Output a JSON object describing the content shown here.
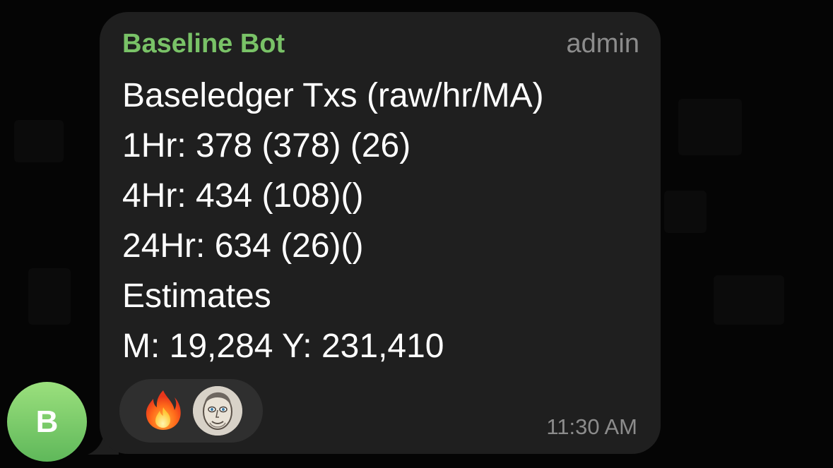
{
  "message": {
    "sender_name": "Baseline Bot",
    "sender_role": "admin",
    "lines": [
      "Baseledger Txs (raw/hr/MA)",
      "1Hr: 378 (378) (26)",
      "4Hr: 434 (108)()",
      "24Hr: 634 (26)()",
      "Estimates",
      "M: 19,284 Y: 231,410"
    ],
    "time": "11:30 AM"
  },
  "reactions": [
    {
      "icon": "fire-emoji-icon"
    },
    {
      "icon": "user-avatar-reaction"
    }
  ],
  "avatar": {
    "letter": "B"
  },
  "colors": {
    "sender_name": "#79c267",
    "bubble": "#1f1f1f",
    "reaction_pill": "#2f2f2f",
    "meta_text": "#8c8c8c",
    "avatar_gradient_top": "#9be07d",
    "avatar_gradient_bottom": "#5fb85a"
  }
}
